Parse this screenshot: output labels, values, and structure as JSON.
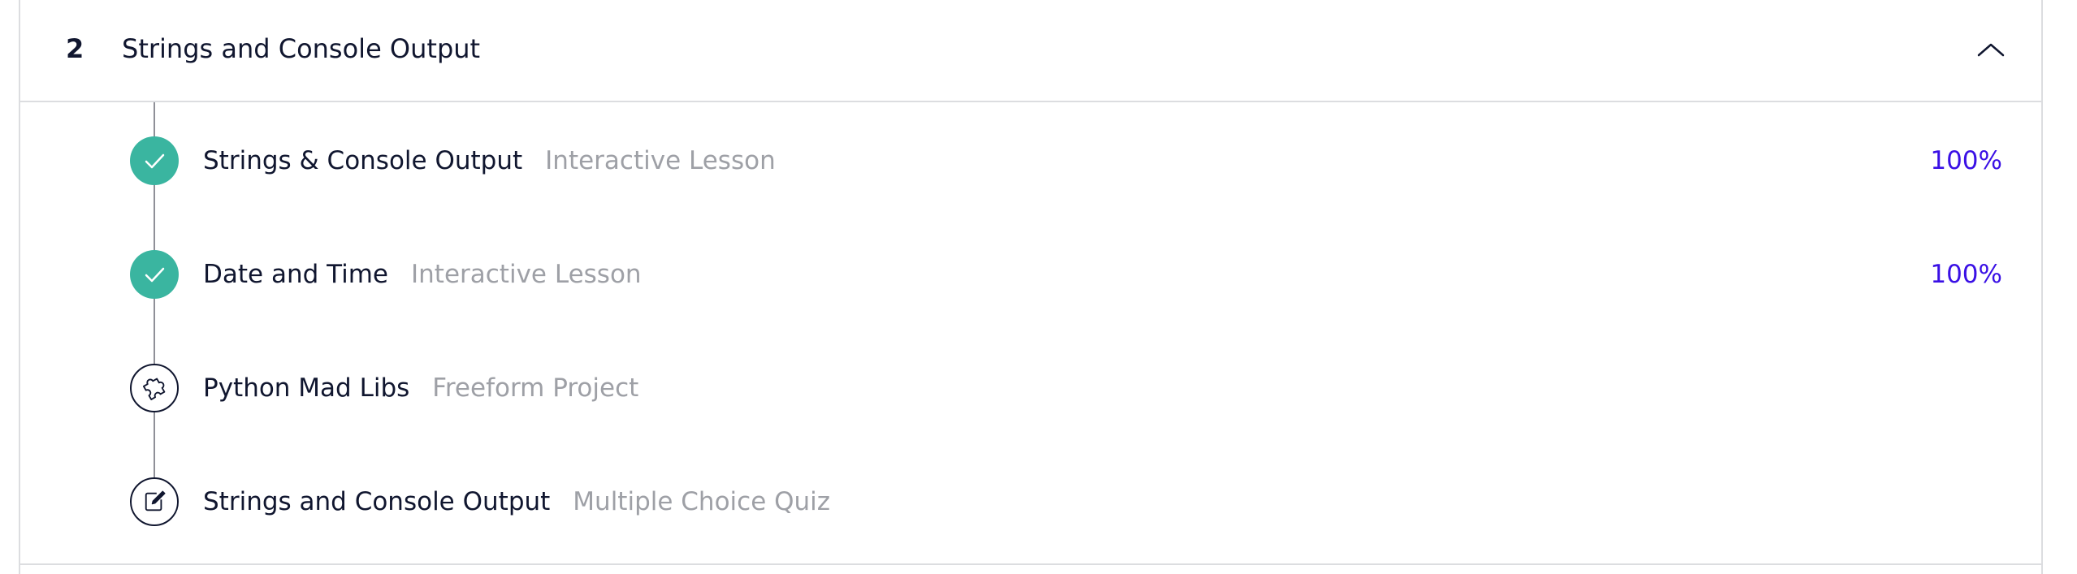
{
  "module": {
    "number": "2",
    "title": "Strings and Console Output",
    "toggle_icon": "chevron-up-icon"
  },
  "lessons": [
    {
      "name": "Strings & Console Output",
      "type": "Interactive Lesson",
      "status": "completed",
      "progress": "100%",
      "icon": "checkmark-icon"
    },
    {
      "name": "Date and Time",
      "type": "Interactive Lesson",
      "status": "completed",
      "progress": "100%",
      "icon": "checkmark-icon"
    },
    {
      "name": "Python Mad Libs",
      "type": "Freeform Project",
      "status": "not-started",
      "progress": "",
      "icon": "puzzle-piece-icon"
    },
    {
      "name": "Strings and Console Output",
      "type": "Multiple Choice Quiz",
      "status": "not-started",
      "progress": "",
      "icon": "quiz-pencil-icon"
    }
  ],
  "colors": {
    "completed": "#3ab5a0",
    "progress_text": "#3a10e5",
    "primary_text": "#10162f",
    "secondary_text": "#9ea0a6",
    "border": "#dcdde0"
  }
}
